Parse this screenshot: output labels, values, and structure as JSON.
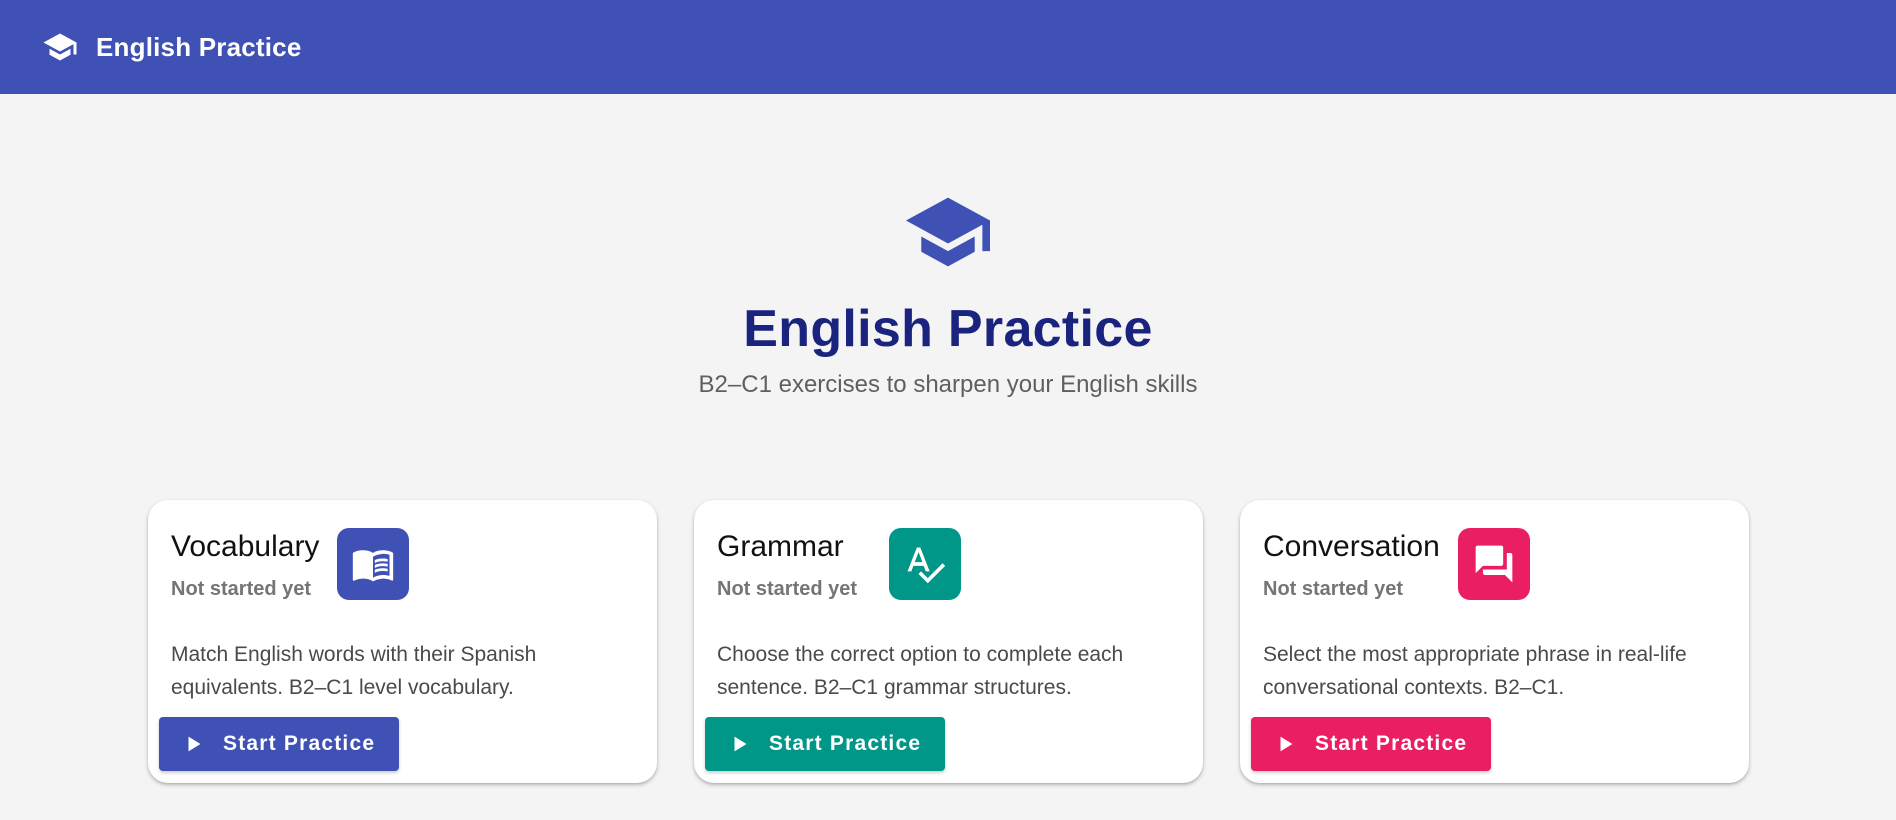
{
  "toolbar": {
    "title": "English Practice",
    "icon": "school-icon"
  },
  "hero": {
    "icon": "school-icon",
    "title": "English Practice",
    "subtitle": "B2–C1 exercises to sharpen your English skills"
  },
  "colors": {
    "primary": "#3f51b5",
    "hero_title": "#1a237e",
    "vocabulary": "#3f51b5",
    "grammar": "#009688",
    "conversation": "#e91e63"
  },
  "cards": [
    {
      "title": "Vocabulary",
      "status": "Not started yet",
      "icon": "book-icon",
      "description": "Match English words with their Spanish equivalents. B2–C1 level vocabulary.",
      "button_label": "Start Practice"
    },
    {
      "title": "Grammar",
      "status": "Not started yet",
      "icon": "spellcheck-icon",
      "description": "Choose the correct option to complete each sentence. B2–C1 grammar structures.",
      "button_label": "Start Practice"
    },
    {
      "title": "Conversation",
      "status": "Not started yet",
      "icon": "chat-bubbles-icon",
      "description": "Select the most appropriate phrase in real-life conversational contexts. B2–C1.",
      "button_label": "Start Practice"
    }
  ]
}
